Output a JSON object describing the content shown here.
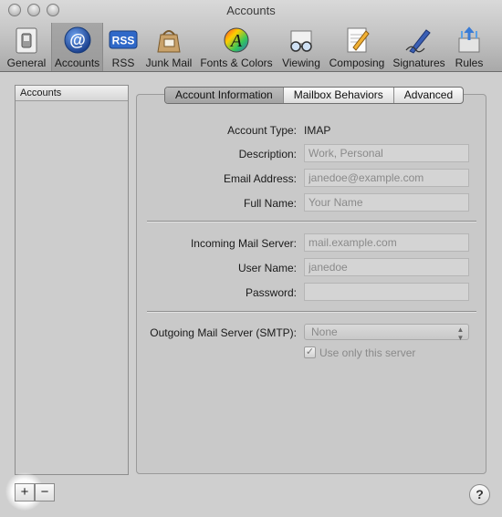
{
  "window": {
    "title": "Accounts"
  },
  "toolbar": {
    "items": [
      {
        "label": "General",
        "icon": "switch-icon"
      },
      {
        "label": "Accounts",
        "icon": "at-sign-icon"
      },
      {
        "label": "RSS",
        "icon": "rss-icon"
      },
      {
        "label": "Junk Mail",
        "icon": "junk-mail-bag-icon"
      },
      {
        "label": "Fonts & Colors",
        "icon": "font-color-wheel-icon"
      },
      {
        "label": "Viewing",
        "icon": "glasses-icon"
      },
      {
        "label": "Composing",
        "icon": "pencil-paper-icon"
      },
      {
        "label": "Signatures",
        "icon": "pen-signature-icon"
      },
      {
        "label": "Rules",
        "icon": "rules-arrows-icon"
      }
    ],
    "rss_badge": "RSS",
    "at_glyph": "@",
    "font_glyph": "A"
  },
  "sidebar": {
    "header": "Accounts",
    "add_label": "+",
    "remove_label": "−"
  },
  "tabs": {
    "items": [
      "Account Information",
      "Mailbox Behaviors",
      "Advanced"
    ],
    "active": "Account Information"
  },
  "form": {
    "account_type_label": "Account Type:",
    "account_type_value": "IMAP",
    "description_label": "Description:",
    "description_placeholder": "Work, Personal",
    "email_label": "Email Address:",
    "email_placeholder": "janedoe@example.com",
    "fullname_label": "Full Name:",
    "fullname_placeholder": "Your Name",
    "incoming_label": "Incoming Mail Server:",
    "incoming_placeholder": "mail.example.com",
    "username_label": "User Name:",
    "username_placeholder": "janedoe",
    "password_label": "Password:",
    "smtp_label": "Outgoing Mail Server (SMTP):",
    "smtp_value": "None",
    "use_only_label": "Use only this server",
    "use_only_checked": true,
    "checkmark": "✓",
    "select_arrows": "▲▼"
  },
  "help": {
    "label": "?"
  },
  "colors": {
    "toolbar_selected": "#9f9f9f",
    "accent_blue": "#1f4fa8"
  }
}
